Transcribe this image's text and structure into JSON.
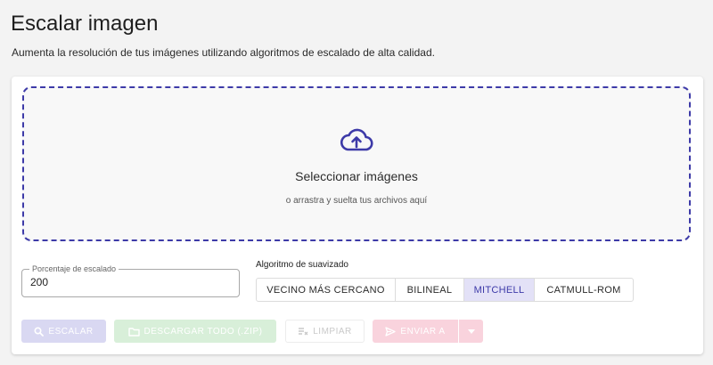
{
  "page": {
    "title": "Escalar imagen",
    "subtitle": "Aumenta la resolución de tus imágenes utilizando algoritmos de escalado de alta calidad."
  },
  "dropzone": {
    "icon": "cloud-upload-icon",
    "title": "Seleccionar imágenes",
    "hint": "o arrastra y suelta tus archivos aquí"
  },
  "scale_field": {
    "label": "Porcentaje de escalado",
    "value": "200"
  },
  "algorithm": {
    "label": "Algoritmo de suavizado",
    "options": [
      "VECINO MÁS CERCANO",
      "BILINEAL",
      "MITCHELL",
      "CATMULL-ROM"
    ],
    "selected": "MITCHELL"
  },
  "actions": {
    "scale": {
      "label": "ESCALAR",
      "icon": "search-icon",
      "enabled": false
    },
    "download_all": {
      "label": "DESCARGAR TODO (.ZIP)",
      "icon": "folder-icon",
      "enabled": false
    },
    "clear": {
      "label": "LIMPIAR",
      "icon": "clear-icon",
      "enabled": false
    },
    "send_to": {
      "label": "ENVIAR A",
      "icon": "send-icon",
      "enabled": false
    },
    "send_to_menu": {
      "icon": "caret-down-icon",
      "enabled": false
    }
  },
  "colors": {
    "accent": "#3d3aa8",
    "selected_bg": "#e3e1f7",
    "scale_disabled": "#d9d8f2",
    "download_disabled": "#d8efd9",
    "send_disabled": "#f9d3dd"
  }
}
